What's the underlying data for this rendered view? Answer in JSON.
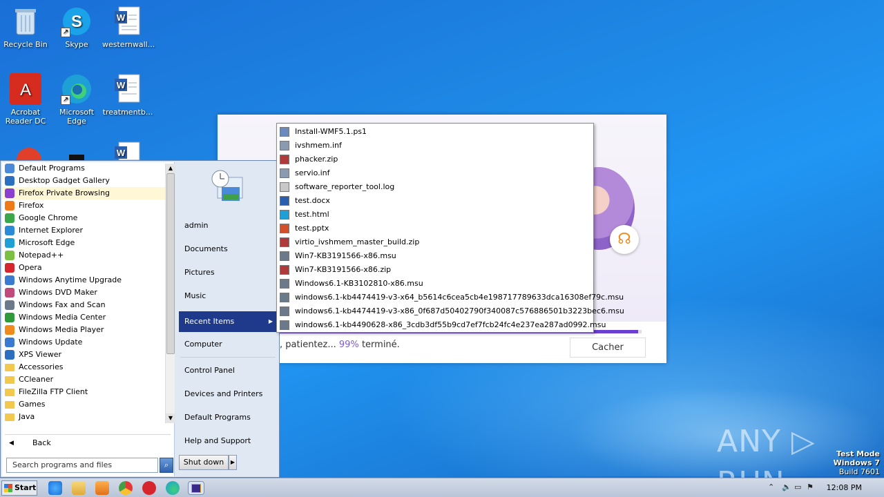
{
  "desktop": {
    "icons": [
      {
        "label": "Recycle Bin"
      },
      {
        "label": "Skype"
      },
      {
        "label": "westernwall..."
      },
      {
        "label": "Acrobat Reader DC"
      },
      {
        "label": "Microsoft Edge"
      },
      {
        "label": "treatmentb..."
      }
    ]
  },
  "dialog": {
    "status_prefix": ", patientez...",
    "percent": "99%",
    "status_suffix": "terminé.",
    "progress_fraction": 0.99,
    "hide_button": "Cacher"
  },
  "start_menu": {
    "programs": [
      {
        "label": "Default Programs",
        "color": "#4a8ad8"
      },
      {
        "label": "Desktop Gadget Gallery",
        "color": "#2a6fc0"
      },
      {
        "label": "Firefox Private Browsing",
        "color": "#8a3fd1"
      },
      {
        "label": "Firefox",
        "color": "#f07a1a"
      },
      {
        "label": "Google Chrome",
        "color": "#3aa84a"
      },
      {
        "label": "Internet Explorer",
        "color": "#2a8ad8"
      },
      {
        "label": "Microsoft Edge",
        "color": "#1e9fd6"
      },
      {
        "label": "Notepad++",
        "color": "#7cc043"
      },
      {
        "label": "Opera",
        "color": "#d6262b"
      },
      {
        "label": "Windows Anytime Upgrade",
        "color": "#3a7ad0"
      },
      {
        "label": "Windows DVD Maker",
        "color": "#c04a7a"
      },
      {
        "label": "Windows Fax and Scan",
        "color": "#6a7a8a"
      },
      {
        "label": "Windows Media Center",
        "color": "#2f9a3a"
      },
      {
        "label": "Windows Media Player",
        "color": "#f08a1c"
      },
      {
        "label": "Windows Update",
        "color": "#3a7ad0"
      },
      {
        "label": "XPS Viewer",
        "color": "#2a6fc0"
      },
      {
        "label": "Accessories",
        "color": "#f2c94c"
      },
      {
        "label": "CCleaner",
        "color": "#f2c94c"
      },
      {
        "label": "FileZilla FTP Client",
        "color": "#f2c94c"
      },
      {
        "label": "Games",
        "color": "#f2c94c"
      },
      {
        "label": "Java",
        "color": "#f2c94c"
      }
    ],
    "back_label": "Back",
    "search_placeholder": "Search programs and files",
    "right_items": {
      "user": "admin",
      "documents": "Documents",
      "pictures": "Pictures",
      "music": "Music",
      "recent": "Recent Items",
      "computer": "Computer",
      "control_panel": "Control Panel",
      "devices": "Devices and Printers",
      "default_programs": "Default Programs",
      "help": "Help and Support"
    },
    "shutdown_label": "Shut down"
  },
  "recent_items": [
    {
      "label": "Install-WMF5.1.ps1",
      "icon_color": "#6a8abf"
    },
    {
      "label": "ivshmem.inf",
      "icon_color": "#8a9ab0"
    },
    {
      "label": "phacker.zip",
      "icon_color": "#b03a3a"
    },
    {
      "label": "servio.inf",
      "icon_color": "#8a9ab0"
    },
    {
      "label": "software_reporter_tool.log",
      "icon_color": "#c8c8c8"
    },
    {
      "label": "test.docx",
      "icon_color": "#2a5fb0"
    },
    {
      "label": "test.html",
      "icon_color": "#1e9fd6"
    },
    {
      "label": "test.pptx",
      "icon_color": "#d2502a"
    },
    {
      "label": "virtio_ivshmem_master_build.zip",
      "icon_color": "#b03a3a"
    },
    {
      "label": "Win7-KB3191566-x86.msu",
      "icon_color": "#6a7a8a"
    },
    {
      "label": "Win7-KB3191566-x86.zip",
      "icon_color": "#b03a3a"
    },
    {
      "label": "Windows6.1-KB3102810-x86.msu",
      "icon_color": "#6a7a8a"
    },
    {
      "label": "windows6.1-kb4474419-v3-x64_b5614c6cea5cb4e198717789633dca16308ef79c.msu",
      "icon_color": "#6a7a8a"
    },
    {
      "label": "windows6.1-kb4474419-v3-x86_0f687d50402790f340087c576886501b3223bec6.msu",
      "icon_color": "#6a7a8a"
    },
    {
      "label": "windows6.1-kb4490628-x86_3cdb3df55b9cd7ef7fcb24fc4e237ea287ad0992.msu",
      "icon_color": "#6a7a8a"
    }
  ],
  "taskbar": {
    "start_label": "Start",
    "clock": "12:08 PM"
  },
  "watermark": {
    "line1": "Test Mode",
    "line2": "Windows 7",
    "line3": "Build 7601",
    "brand": "ANY ▷ RUN"
  }
}
